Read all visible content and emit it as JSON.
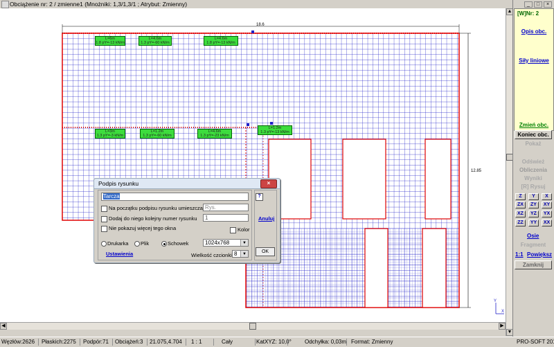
{
  "window": {
    "title": "Obciążenie nr: 2 / zmienne1 (Mnożniki: 1,3/1,3/1 ; Atrybut: Zmienny)"
  },
  "window_controls": {
    "minimize": "_",
    "maximize": "□",
    "close": "×"
  },
  "drawing": {
    "dim_top": "18.6",
    "dim_right": "12.85",
    "loads_top": [
      {
        "line1": "L=6m",
        "line2": "1.8 pY=-13 kN/m"
      },
      {
        "line1": "L=4.6m",
        "line2": "1.3 pY=-60 kN/m"
      },
      {
        "line1": "L=4.6m",
        "line2": "1.8 pY=-13 kN/m"
      }
    ],
    "loads_mid": [
      {
        "line1": "L=3m",
        "line2": "1.3 pY=-3 kN/m"
      },
      {
        "line1": "L=1.2m",
        "line2": "1.3 pY=-60 kN/m"
      },
      {
        "line1": "L=4.6m",
        "line2": "1.3 pY=-23 kN/m"
      },
      {
        "line1": "L=1.2m",
        "line2": "1.3 pY=-13 kN/m"
      }
    ],
    "axes": {
      "x": "X",
      "y": "Y"
    }
  },
  "panel": {
    "wj": "[W]Nr: 2",
    "opis_obc": "Opis obc.",
    "sily_liniowe": "Siły liniowe",
    "zmien_obc": "Zmień obc.",
    "koniec_obc": "Koniec obc.",
    "pokaz": "Pokaż",
    "odswiez": "Odśwież",
    "obliczenia": "Obliczenia",
    "wyniki": "Wyniki",
    "rysuj": "[R] Rysuj",
    "view_buttons": [
      "Z",
      "Y",
      "X",
      "ZX",
      "ZY",
      "XY",
      "XZ",
      "YZ",
      "YX",
      "ZZ",
      "YY",
      "XX"
    ],
    "osie": "Osie",
    "fragment": "Fragment",
    "skala": "1:1",
    "powieksz": "Powiększ",
    "zamknij": "Zamknij"
  },
  "dialog": {
    "title": "Podpis rysunku",
    "close": "×",
    "text_value": "Tarcza",
    "help": "?",
    "cb1_label": "Na początku podpisu rysunku umieszczaj tekst:",
    "cb1_input": "Rys.",
    "cb2_label": "Dodaj do niego kolejny numer rysunku",
    "number_value": "1",
    "cb3_label": "Nie pokazuj więcej tego okna",
    "color_label": "Kolor",
    "cancel": "Anuluj",
    "radio_printer": "Drukarka",
    "radio_file": "Plik",
    "radio_clipboard": "Schowek",
    "resolution": "1024x768",
    "ok": "OK",
    "settings": "Ustawienia",
    "font_size_label": "Wielkość czcionki",
    "font_size": "8"
  },
  "status": {
    "wezlow": "Węzłów:2626",
    "plaskich": "Płaskich:2275",
    "podpor": "Podpór:71",
    "obciazen": "Obciążeń:3",
    "coords": "21.075,4.704",
    "scale": "1 : 1",
    "view": "Cały",
    "katxyz": "KatXYZ: 10,0°",
    "odchylka": "Odchyłka: 0,03m",
    "format": "Format: Zmienny",
    "brand": "PRO-SOFT 2017"
  }
}
